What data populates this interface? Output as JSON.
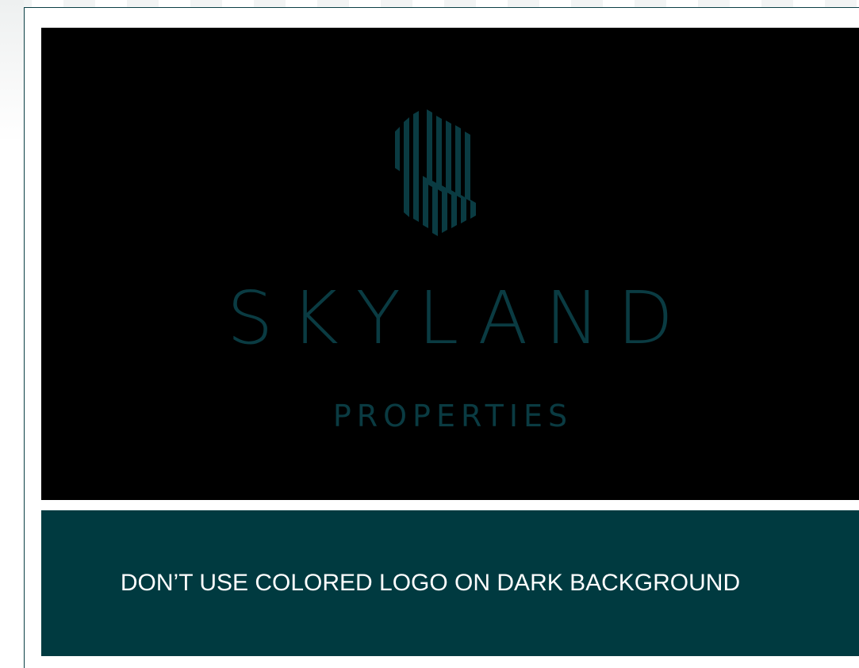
{
  "logo": {
    "name": "SKYLAND",
    "tagline": "PROPERTIES",
    "mark_icon": "skyland-stripes-icon",
    "color": "#0a3b42"
  },
  "caption": {
    "text": "DON’T USE COLORED LOGO ON DARK BACKGROUND"
  },
  "colors": {
    "dark_background": "#000000",
    "caption_background": "#003a40",
    "caption_text": "#ffffff",
    "frame_border": "#0b3f45"
  }
}
